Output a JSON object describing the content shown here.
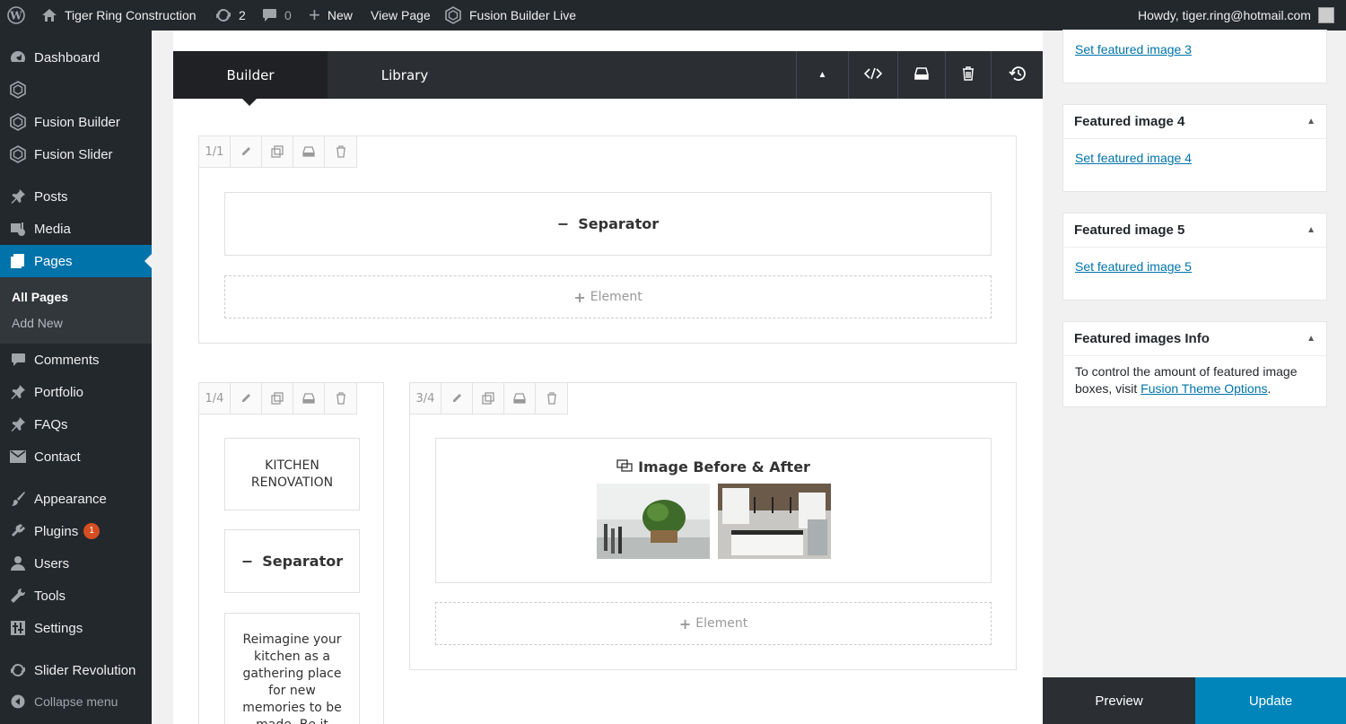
{
  "adminbar": {
    "site_name": "Tiger Ring Construction",
    "updates_count": "2",
    "comments_count": "0",
    "new_label": "New",
    "view_page_label": "View Page",
    "fusion_live_label": "Fusion Builder Live",
    "howdy": "Howdy, tiger.ring@hotmail.com"
  },
  "menu": {
    "dashboard": "Dashboard",
    "fusion_builder": "Fusion Builder",
    "fusion_slider": "Fusion Slider",
    "posts": "Posts",
    "media": "Media",
    "pages": "Pages",
    "all_pages": "All Pages",
    "add_new": "Add New",
    "comments": "Comments",
    "portfolio": "Portfolio",
    "faqs": "FAQs",
    "contact": "Contact",
    "appearance": "Appearance",
    "plugins": "Plugins",
    "plugins_badge": "1",
    "users": "Users",
    "tools": "Tools",
    "settings": "Settings",
    "slider_revolution": "Slider Revolution",
    "collapse": "Collapse menu"
  },
  "builder": {
    "tab_builder": "Builder",
    "tab_library": "Library",
    "container1": {
      "col_size": "1/1",
      "separator_label": "Separator",
      "add_element": "Element"
    },
    "container2": {
      "col_left_size": "1/4",
      "col_right_size": "3/4",
      "kitchen_text": "KITCHEN RENOVATION",
      "separator_label": "Separator",
      "text_block": "Reimagine your kitchen as a gathering place for new memories to be made. Be it",
      "before_after_label": "Image Before & After",
      "add_element": "Element"
    }
  },
  "sidebar_boxes": {
    "set_featured_3": "Set featured image 3",
    "featured_4_title": "Featured image 4",
    "set_featured_4": "Set featured image 4",
    "featured_5_title": "Featured image 5",
    "set_featured_5": "Set featured image 5",
    "info_title": "Featured images Info",
    "info_text": "To control the amount of featured image boxes, visit",
    "info_link": "Fusion Theme Options",
    "info_period": "."
  },
  "actions": {
    "preview": "Preview",
    "update": "Update"
  },
  "colors": {
    "admin_dark": "#23282d",
    "accent_blue": "#0073aa",
    "builder_header": "#2b2e33"
  }
}
